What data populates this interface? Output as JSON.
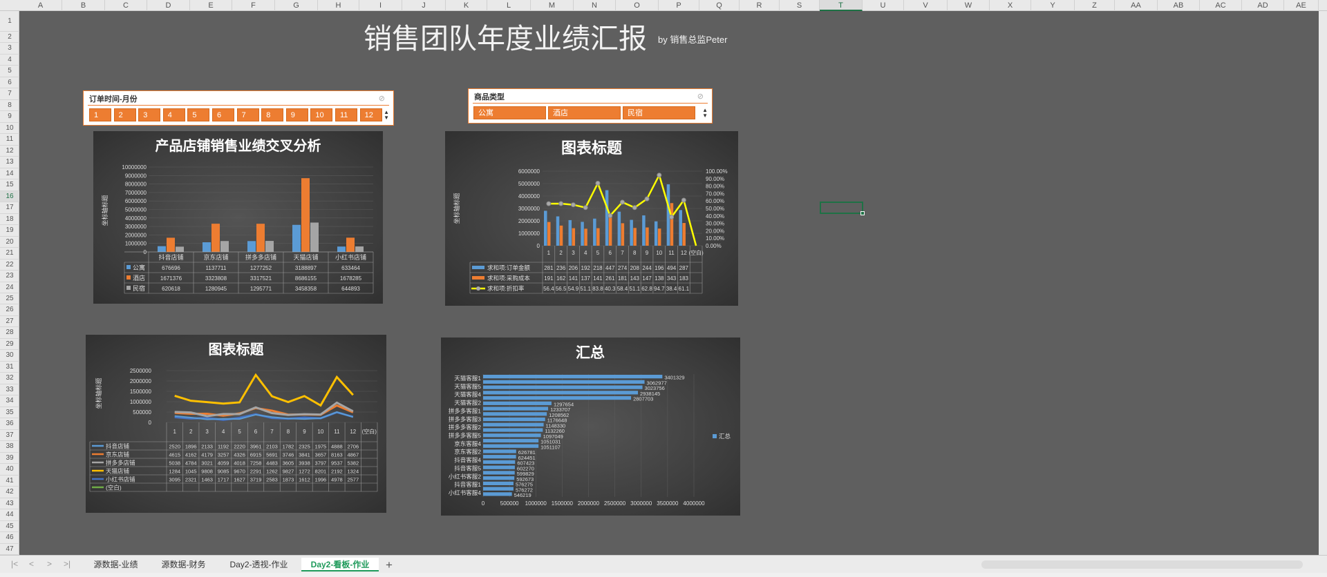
{
  "columns": [
    "A",
    "B",
    "C",
    "D",
    "E",
    "F",
    "G",
    "H",
    "I",
    "J",
    "K",
    "L",
    "M",
    "N",
    "O",
    "P",
    "Q",
    "R",
    "S",
    "T",
    "U",
    "V",
    "W",
    "X",
    "Y",
    "Z",
    "AA",
    "AB",
    "AC",
    "AD",
    "AE"
  ],
  "active_column": "T",
  "rows": [
    "1",
    "2",
    "3",
    "4",
    "5",
    "6",
    "7",
    "8",
    "9",
    "10",
    "11",
    "12",
    "13",
    "14",
    "15",
    "16",
    "17",
    "18",
    "19",
    "20",
    "21",
    "22",
    "23",
    "24",
    "25",
    "26",
    "27",
    "28",
    "29",
    "30",
    "31",
    "32",
    "33",
    "34",
    "35",
    "36",
    "37",
    "38",
    "39",
    "40",
    "41",
    "42",
    "43",
    "44",
    "45",
    "46",
    "47"
  ],
  "active_row": "16",
  "dashboard": {
    "title": "销售团队年度业绩汇报",
    "subtitle": "by 销售总监Peter"
  },
  "slicer_month": {
    "header": "订单时间-月份",
    "items": [
      "1",
      "2",
      "3",
      "4",
      "5",
      "6",
      "7",
      "8",
      "9",
      "10",
      "11",
      "12"
    ]
  },
  "slicer_type": {
    "header": "商品类型",
    "items": [
      "公寓",
      "酒店",
      "民宿"
    ]
  },
  "colors": {
    "blue": "#5b9bd5",
    "orange": "#ed7d31",
    "gray": "#a5a5a5",
    "yellow": "#ffc000",
    "navy": "#4472c4",
    "green": "#70ad47",
    "line_yellow": "#ffff00"
  },
  "tabs": [
    "源数据-业绩",
    "源数据-财务",
    "Day2-透视-作业",
    "Day2-看板-作业"
  ],
  "active_tab": "Day2-看板-作业",
  "chart_data": [
    {
      "type": "bar",
      "title": "产品店铺销售业绩交叉分析",
      "ylabel": "坐标轴标题",
      "ylim": [
        0,
        10000000
      ],
      "yticks": [
        "10000000",
        "9000000",
        "8000000",
        "7000000",
        "6000000",
        "5000000",
        "4000000",
        "3000000",
        "2000000",
        "1000000",
        "0"
      ],
      "categories": [
        "抖音店铺",
        "京东店铺",
        "拼多多店铺",
        "天猫店铺",
        "小红书店铺"
      ],
      "series": [
        {
          "name": "公寓",
          "values": [
            676696,
            1137711,
            1277252,
            3188897,
            633464
          ],
          "labels": [
            "676696",
            "1137711",
            "1277252",
            "3188897",
            "633464"
          ]
        },
        {
          "name": "酒店",
          "values": [
            1671376,
            3323808,
            3317521,
            8686155,
            1678285
          ],
          "labels": [
            "1671376",
            "3323808",
            "3317521",
            "8686155",
            "1678285"
          ]
        },
        {
          "name": "民宿",
          "values": [
            620618,
            1280945,
            1295771,
            3458358,
            644893
          ],
          "labels": [
            "620618",
            "1280945",
            "1295771",
            "3458358",
            "644893"
          ]
        }
      ]
    },
    {
      "type": "bar",
      "title": "图表标题",
      "ylabel": "坐标轴标题",
      "ylim": [
        0,
        6000000
      ],
      "yticks": [
        "6000000",
        "5000000",
        "4000000",
        "3000000",
        "2000000",
        "1000000",
        "0"
      ],
      "y2ticks": [
        "100.00%",
        "90.00%",
        "80.00%",
        "70.00%",
        "60.00%",
        "50.00%",
        "40.00%",
        "30.00%",
        "20.00%",
        "10.00%",
        "0.00%"
      ],
      "categories": [
        "1",
        "2",
        "3",
        "4",
        "5",
        "6",
        "7",
        "8",
        "9",
        "10",
        "11",
        "12",
        "(空白)"
      ],
      "series": [
        {
          "name": "求和项:订单金额",
          "values": [
            2810000,
            2360000,
            2060000,
            1920000,
            2180000,
            4470000,
            2740000,
            2080000,
            2440000,
            1960000,
            4940000,
            2870000,
            0
          ],
          "labels": [
            "281",
            "236",
            "206",
            "192",
            "218",
            "447",
            "274",
            "208",
            "244",
            "196",
            "494",
            "287",
            ""
          ]
        },
        {
          "name": "求和项:采购成本",
          "values": [
            1910000,
            1620000,
            1410000,
            1370000,
            1410000,
            2610000,
            1810000,
            1430000,
            1470000,
            1380000,
            3430000,
            1830000,
            0
          ],
          "labels": [
            "191",
            "162",
            "141",
            "137",
            "141",
            "261",
            "181",
            "143",
            "147",
            "138",
            "343",
            "183",
            ""
          ]
        },
        {
          "name": "求和项:折扣率",
          "axis": "secondary",
          "values": [
            0.564,
            0.565,
            0.549,
            0.511,
            0.838,
            0.403,
            0.584,
            0.511,
            0.628,
            0.947,
            0.384,
            0.611,
            0
          ],
          "labels": [
            "56.4",
            "56.5",
            "54.9",
            "51.1",
            "83.8",
            "40.3",
            "58.4",
            "51.1",
            "62.8",
            "94.7",
            "38.4",
            "61.1",
            ""
          ]
        }
      ]
    },
    {
      "type": "line",
      "title": "图表标题",
      "ylabel": "坐标轴标题",
      "ylim": [
        0,
        2500000
      ],
      "yticks": [
        "2500000",
        "2000000",
        "1500000",
        "1000000",
        "500000",
        "0"
      ],
      "categories": [
        "1",
        "2",
        "3",
        "4",
        "5",
        "6",
        "7",
        "8",
        "9",
        "10",
        "11",
        "12",
        "(空白)"
      ],
      "series": [
        {
          "name": "抖音店铺",
          "values": [
            252000,
            189600,
            213300,
            119200,
            222000,
            396100,
            210300,
            178200,
            232500,
            197500,
            488800,
            270600
          ],
          "labels": [
            "2520",
            "1896",
            "2133",
            "1192",
            "2220",
            "3961",
            "2103",
            "1782",
            "2325",
            "1975",
            "4888",
            "2706"
          ]
        },
        {
          "name": "京东店铺",
          "values": [
            461500,
            416200,
            417900,
            325700,
            432600,
            691500,
            569100,
            374600,
            384100,
            365700,
            816300,
            486700
          ],
          "labels": [
            "4615",
            "4162",
            "4179",
            "3257",
            "4326",
            "6915",
            "5691",
            "3746",
            "3841",
            "3657",
            "8163",
            "4867"
          ]
        },
        {
          "name": "拼多多店铺",
          "values": [
            503800,
            478400,
            302100,
            405900,
            401800,
            725800,
            448300,
            360500,
            393800,
            379700,
            953700,
            538200
          ],
          "labels": [
            "5038",
            "4784",
            "3021",
            "4059",
            "4018",
            "7258",
            "4483",
            "3605",
            "3938",
            "3797",
            "9537",
            "5382"
          ]
        },
        {
          "name": "天猫店铺",
          "values": [
            1284000,
            1045000,
            980800,
            908500,
            967000,
            2291000,
            1262000,
            982700,
            1272000,
            820100,
            2192000,
            1324000
          ],
          "labels": [
            "1284",
            "1045",
            "9808",
            "9085",
            "9670",
            "2291",
            "1262",
            "9827",
            "1272",
            "8201",
            "2192",
            "1324"
          ]
        },
        {
          "name": "小红书店铺",
          "values": [
            309500,
            232100,
            146300,
            171700,
            162700,
            371900,
            258300,
            187300,
            161200,
            199600,
            497800,
            257700
          ],
          "labels": [
            "3095",
            "2321",
            "1463",
            "1717",
            "1627",
            "3719",
            "2583",
            "1873",
            "1612",
            "1996",
            "4978",
            "2577"
          ]
        },
        {
          "name": "(空白)",
          "values": [],
          "labels": []
        }
      ]
    },
    {
      "type": "bar",
      "orientation": "horizontal",
      "title": "汇总",
      "xlim": [
        0,
        4000000
      ],
      "xticks": [
        "0",
        "500000",
        "1000000",
        "1500000",
        "2000000",
        "2500000",
        "3000000",
        "3500000",
        "4000000"
      ],
      "legend": "汇总",
      "category_labels": [
        "天猫客服1",
        "天猫客服5",
        "天猫客服4",
        "天猫客服2",
        "拼多多客服1",
        "拼多多客服3",
        "拼多多客服2",
        "拼多多客服5",
        "京东客服4",
        "京东客服2",
        "抖音客服4",
        "抖音客服5",
        "小红书客服2",
        "抖音客服1",
        "小红书客服4"
      ],
      "values": [
        3401329,
        3062977,
        3023756,
        2938145,
        2807703,
        1297654,
        1233707,
        1208562,
        1176648,
        1148330,
        1132260,
        1097049,
        1051031,
        1051107,
        626781,
        624451,
        607423,
        602270,
        599829,
        592673,
        576275,
        576272,
        546219
      ],
      "labels": [
        "3401329",
        "3062977",
        "3023756",
        "2938145",
        "2807703",
        "1297654",
        "1233707",
        "1208562",
        "1176648",
        "1148330",
        "1132260",
        "1097049",
        "1051031",
        "1051107",
        "626781",
        "624451",
        "607423",
        "602270",
        "599829",
        "592673",
        "576275",
        "576272",
        "546219"
      ]
    }
  ]
}
